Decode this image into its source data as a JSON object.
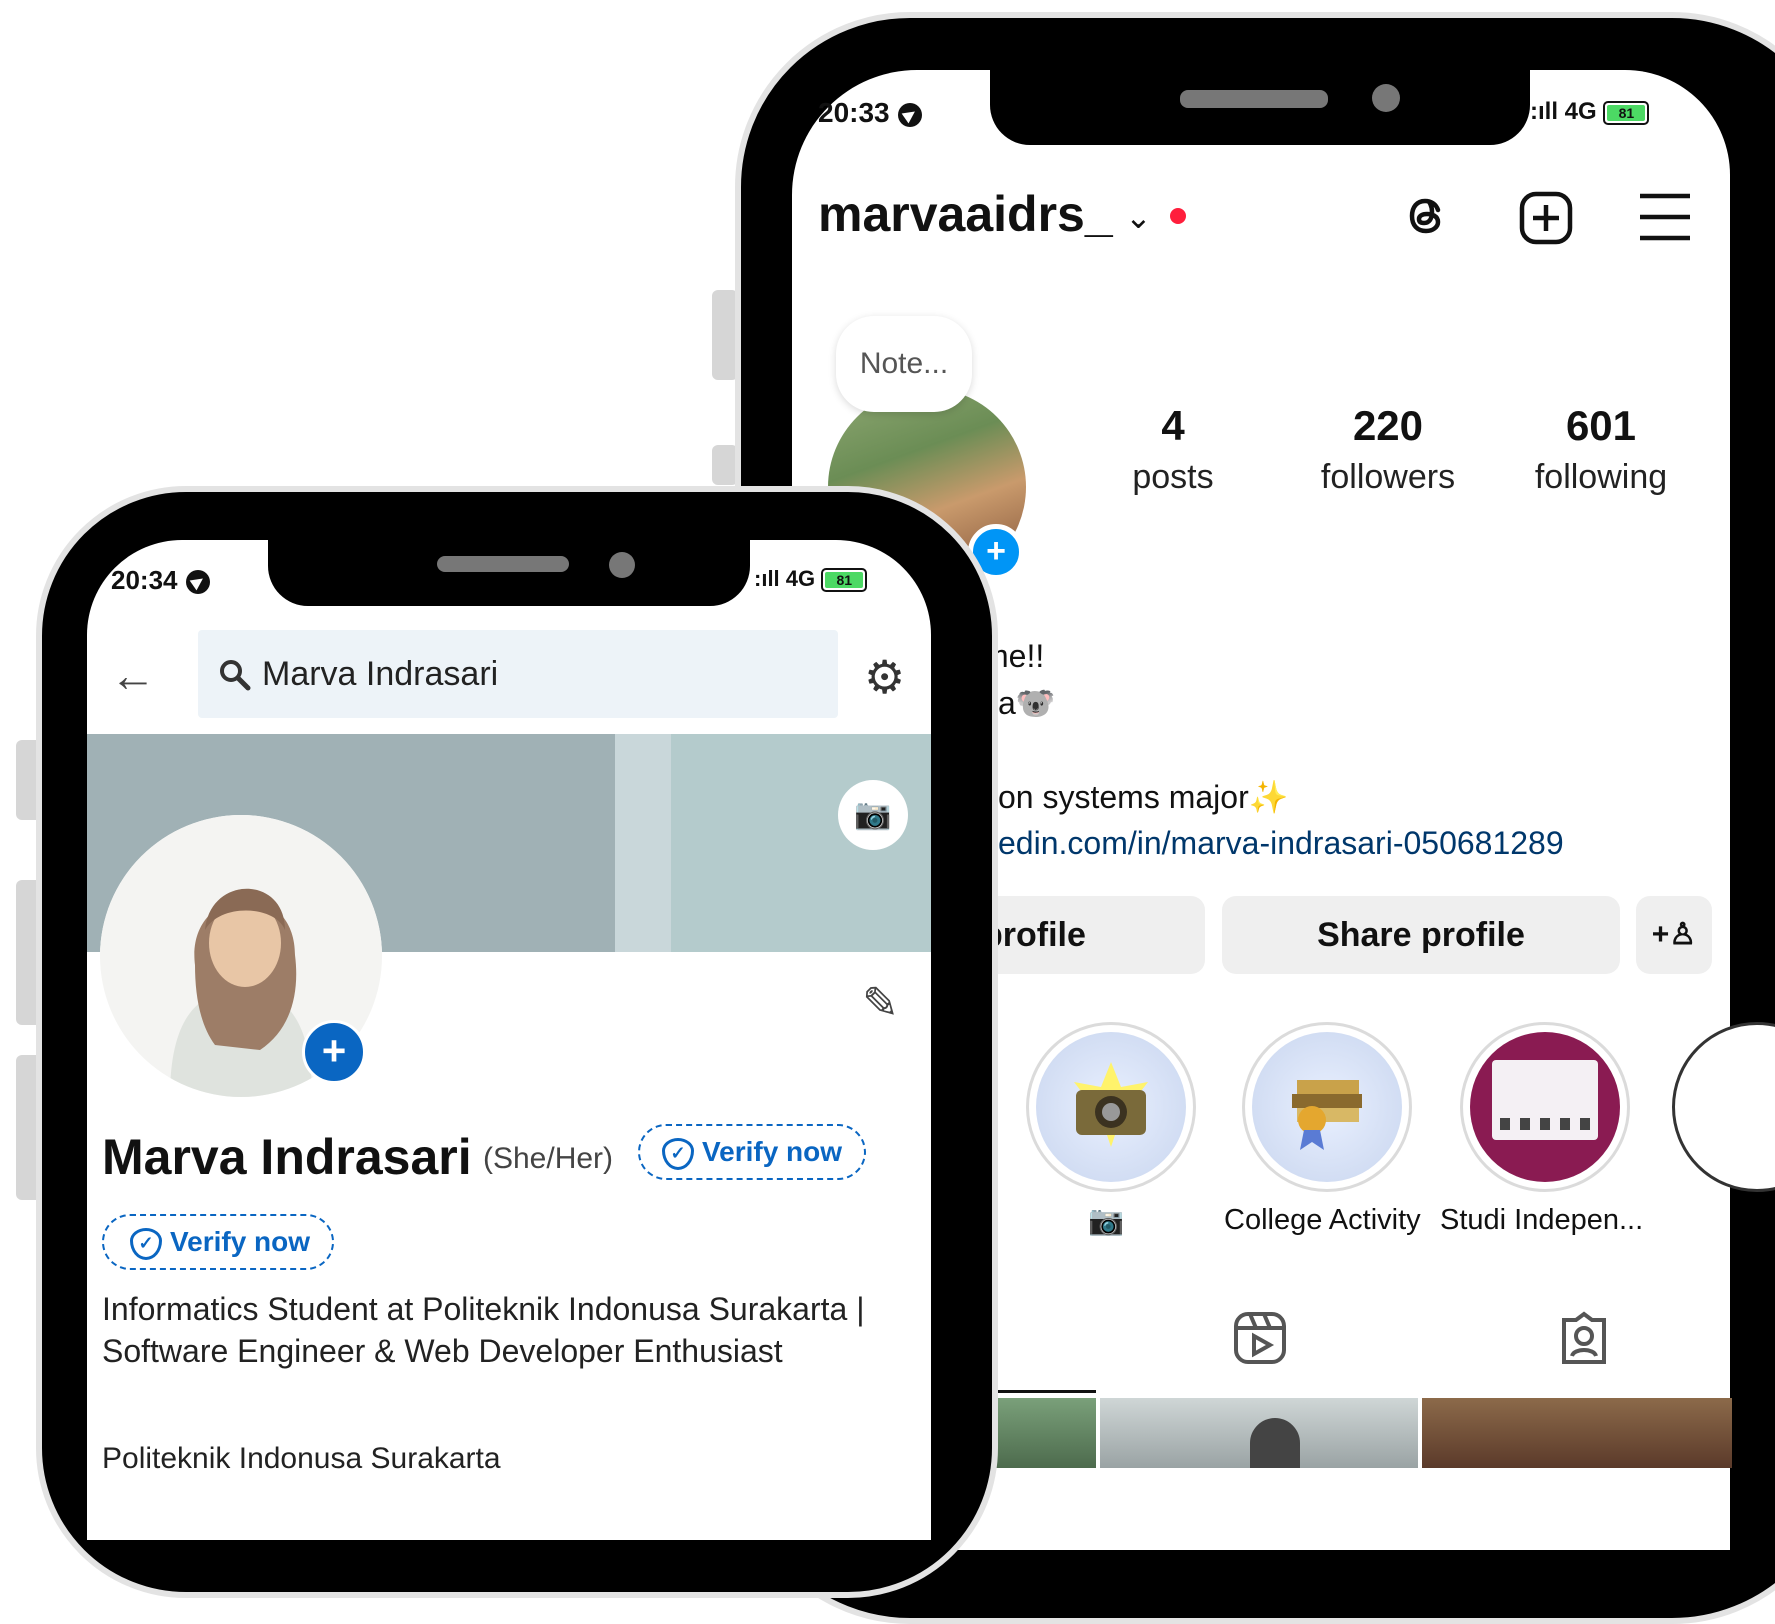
{
  "instagram": {
    "status": {
      "time": "20:33",
      "network": "4G",
      "battery": "81"
    },
    "username": "marvaaidrs_",
    "note_bubble": "Note...",
    "stats": [
      {
        "value": "4",
        "label": "posts"
      },
      {
        "value": "220",
        "label": "followers"
      },
      {
        "value": "601",
        "label": "following"
      }
    ],
    "bio_lines": [
      "_",
      "me!!",
      "va🐨",
      "tion systems major✨"
    ],
    "bio_link": "kedin.com/in/marva-indrasari-050681289",
    "buttons": {
      "edit": "profile",
      "share": "Share profile"
    },
    "highlights": [
      {
        "label": "📷"
      },
      {
        "label": "College Activity"
      },
      {
        "label": "Studi Indepen..."
      }
    ],
    "icons": [
      "threads-icon",
      "add-post-icon",
      "menu-icon",
      "reels-tab-icon",
      "tagged-tab-icon"
    ]
  },
  "linkedin": {
    "status": {
      "time": "20:34",
      "network": "4G",
      "battery": "81"
    },
    "search_value": "Marva Indrasari",
    "name": "Marva Indrasari",
    "pronouns": "(She/Her)",
    "verify_label": "Verify now",
    "headline": "Informatics Student at Politeknik Indonusa Surakarta | Software Engineer & Web Developer Enthusiast",
    "company": "Politeknik Indonusa Surakarta",
    "colors": {
      "accent": "#0a66c2",
      "search_bg": "#edf3f8"
    }
  }
}
